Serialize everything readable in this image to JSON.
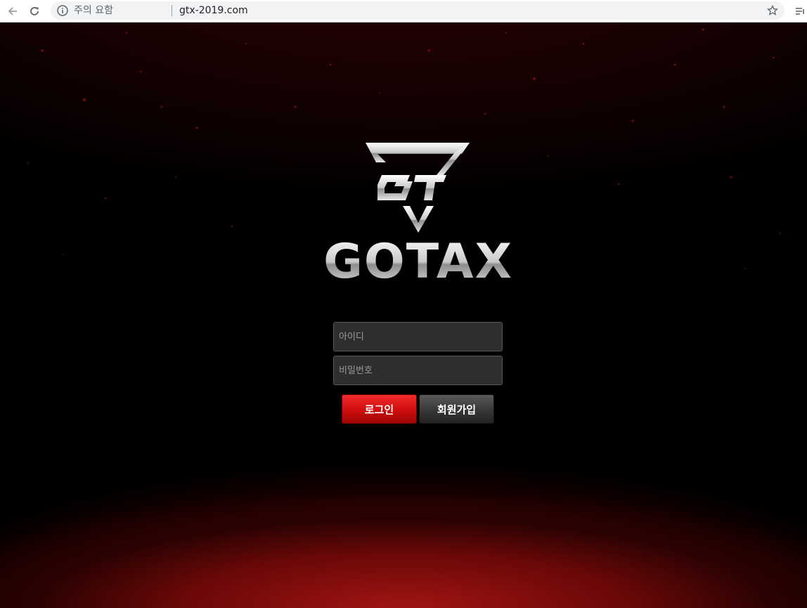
{
  "browser": {
    "security_warning": "주의 요함",
    "url": "gtx-2019.com",
    "icons": [
      "back-arrow-icon",
      "reload-icon",
      "info-icon",
      "star-icon",
      "menu-icon"
    ]
  },
  "logo": {
    "wordmark": "GOTAX",
    "emblem_letters": "GT"
  },
  "login": {
    "id_placeholder": "아이디",
    "password_placeholder": "비밀번호",
    "login_label": "로그인",
    "join_label": "회원가입"
  },
  "colors": {
    "accent_red": "#d10f0f",
    "button_dark": "#3a3a3a",
    "background": "#000000"
  }
}
